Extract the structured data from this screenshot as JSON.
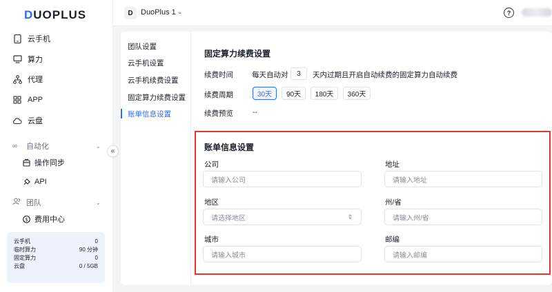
{
  "brand": {
    "logo_first": "D",
    "logo_rest": "UOPLUS"
  },
  "sidebar": {
    "items": [
      {
        "label": "云手机",
        "icon": "phone-icon"
      },
      {
        "label": "算力",
        "icon": "monitor-icon"
      },
      {
        "label": "代理",
        "icon": "network-icon"
      },
      {
        "label": "APP",
        "icon": "grid-icon"
      },
      {
        "label": "云盘",
        "icon": "cloud-icon"
      }
    ],
    "automation": {
      "label": "自动化",
      "sub": [
        {
          "label": "操作同步"
        },
        {
          "label": "API"
        }
      ]
    },
    "team": {
      "label": "团队",
      "sub": [
        {
          "label": "费用中心"
        }
      ]
    },
    "stats": [
      {
        "label": "云手机",
        "value": "0"
      },
      {
        "label": "临时算力",
        "value": "90 分钟"
      },
      {
        "label": "固定算力",
        "value": "0"
      },
      {
        "label": "云盘",
        "value": "0 / 5GB"
      }
    ]
  },
  "topbar": {
    "team_badge": "D",
    "team_name": "DuoPlus 1"
  },
  "settings_nav": [
    {
      "label": "团队设置"
    },
    {
      "label": "云手机设置"
    },
    {
      "label": "云手机续费设置"
    },
    {
      "label": "固定算力续费设置"
    },
    {
      "label": "账单信息设置"
    }
  ],
  "renew": {
    "title": "固定算力续费设置",
    "time_label": "续费时间",
    "time_prefix": "每天自动对",
    "days_value": "3",
    "time_suffix": "天内过期且开启自动续费的固定算力自动续费",
    "period_label": "续费周期",
    "periods": [
      "30天",
      "90天",
      "180天",
      "360天"
    ],
    "active_period": "30天",
    "preview_label": "续费预览",
    "preview_value": "--"
  },
  "billing": {
    "title": "账单信息设置",
    "fields": {
      "company": {
        "label": "公司",
        "placeholder": "请输入公司"
      },
      "address": {
        "label": "地址",
        "placeholder": "请输入地址"
      },
      "region": {
        "label": "地区",
        "placeholder": "请选择地区"
      },
      "state": {
        "label": "州/省",
        "placeholder": "请输入州/省"
      },
      "city": {
        "label": "城市",
        "placeholder": "请输入城市"
      },
      "postal": {
        "label": "邮编",
        "placeholder": "请输入邮编"
      }
    }
  },
  "colors": {
    "accent": "#2d6cf6",
    "highlight_border": "#e0362c"
  }
}
